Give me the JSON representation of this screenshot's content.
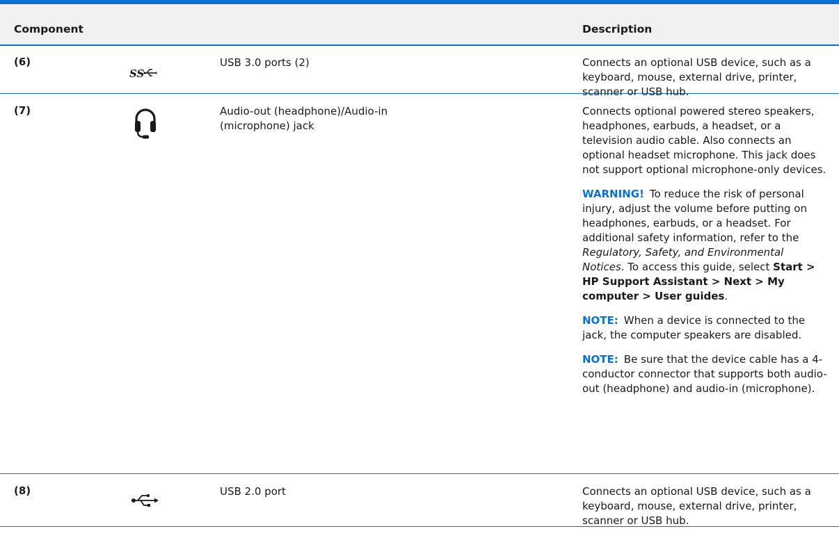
{
  "header": {
    "component": "Component",
    "description": "Description"
  },
  "rows": [
    {
      "num": "(6)",
      "icon": "usb-superspeed-icon",
      "name": "USB 3.0 ports (2)",
      "desc": "Connects an optional USB device, such as a keyboard, mouse, external drive, printer, scanner or USB hub."
    },
    {
      "num": "(7)",
      "icon": "headset-icon",
      "name": "Audio-out (headphone)/Audio-in (microphone) jack",
      "desc": "Connects optional powered stereo speakers, headphones, earbuds, a headset, or a television audio cable. Also connects an optional headset microphone. This jack does not support optional microphone-only devices.",
      "warning": {
        "label": "WARNING!",
        "text1": "To reduce the risk of personal injury, adjust the volume before putting on headphones, earbuds, or a headset. For additional safety information, refer to the",
        "italic": "Regulatory, Safety, and Environmental Notices",
        "text2": ". To access this guide, select",
        "bold": "Start > HP Support Assistant > Next > My computer > User guides",
        "end": "."
      },
      "note1": {
        "label": "NOTE:",
        "text": "When a device is connected to the jack, the computer speakers are disabled."
      },
      "note2": {
        "label": "NOTE:",
        "text": "Be sure that the device cable has a 4-conductor connector that supports both audio-out (headphone) and audio-in (microphone)."
      }
    },
    {
      "num": "(8)",
      "icon": "usb-icon",
      "name": "USB 2.0 port",
      "desc": "Connects an optional USB device, such as a keyboard, mouse, external drive, printer, scanner or USB hub."
    }
  ],
  "colors": {
    "accent": "#0a71d1",
    "header_bg": "#f1f1f1"
  }
}
